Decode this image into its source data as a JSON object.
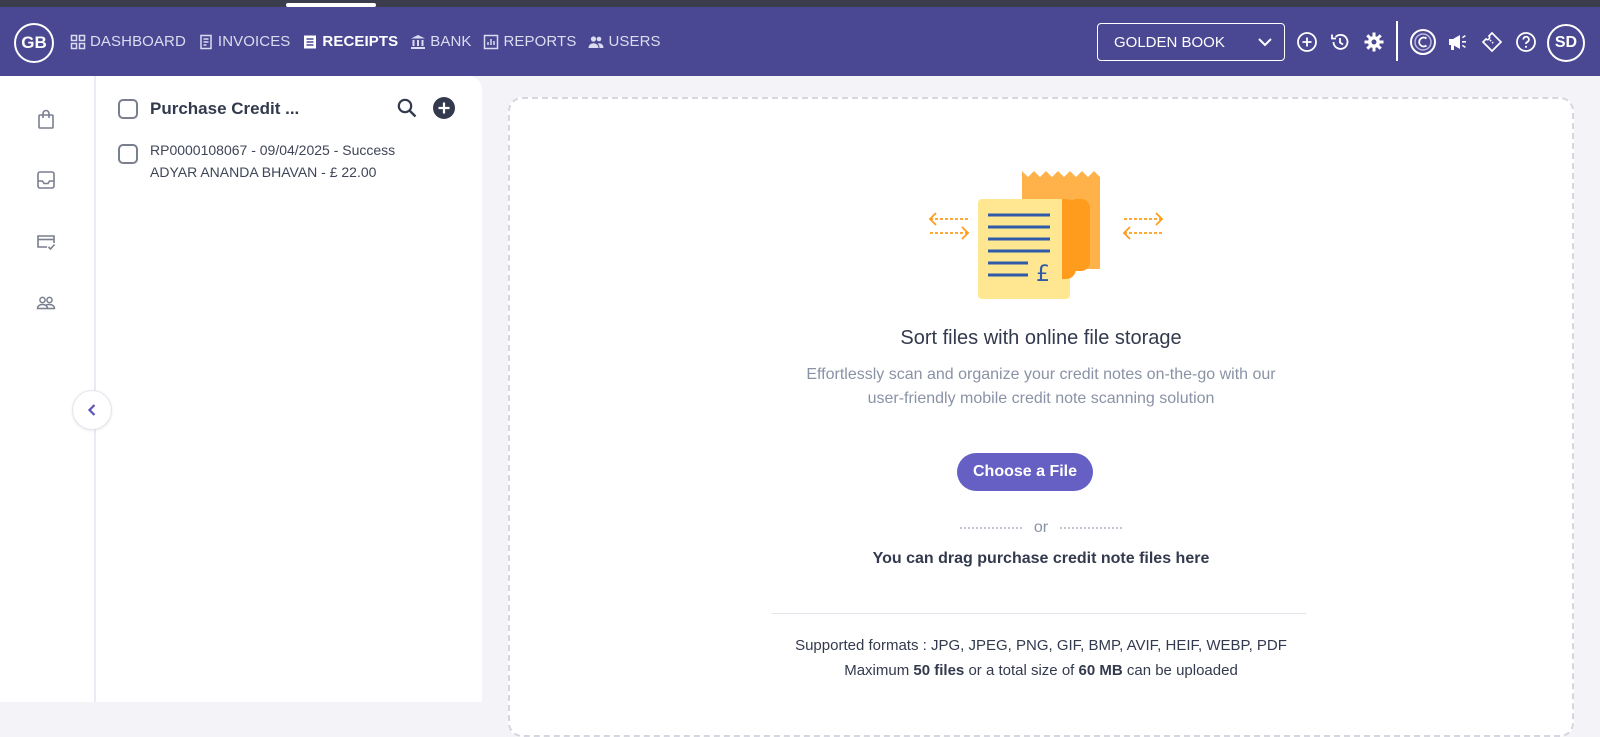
{
  "header": {
    "logo_text": "GB",
    "nav": [
      {
        "label": "DASHBOARD",
        "icon": "grid-icon",
        "active": false
      },
      {
        "label": "INVOICES",
        "icon": "invoice-icon",
        "active": false
      },
      {
        "label": "RECEIPTS",
        "icon": "receipt-icon",
        "active": true
      },
      {
        "label": "BANK",
        "icon": "bank-icon",
        "active": false
      },
      {
        "label": "REPORTS",
        "icon": "reports-icon",
        "active": false
      },
      {
        "label": "USERS",
        "icon": "users-icon",
        "active": false
      }
    ],
    "book_select": "GOLDEN BOOK",
    "avatar": "SD",
    "accent": "#4a4893"
  },
  "list": {
    "title": "Purchase Credit ...",
    "rows": [
      {
        "line1": "RP0000108067 - 09/04/2025 - Success",
        "line2": "ADYAR ANANDA BHAVAN - £ 22.00"
      }
    ]
  },
  "upload": {
    "title": "Sort files with online file storage",
    "desc_line1": "Effortlessly scan and organize your credit notes on-the-go with our",
    "desc_line2": "user-friendly mobile credit note scanning solution",
    "choose_button": "Choose a File",
    "or": "or",
    "drag_text": "You can drag purchase credit note files here",
    "formats_text": "Supported formats : JPG, JPEG, PNG, GIF, BMP, AVIF, HEIF, WEBP, PDF",
    "max_prefix": "Maximum",
    "max_files": "50 files",
    "max_middle": "or a total size of",
    "max_size": "60 MB",
    "max_suffix": "can be uploaded",
    "button_color": "#6660c4"
  }
}
